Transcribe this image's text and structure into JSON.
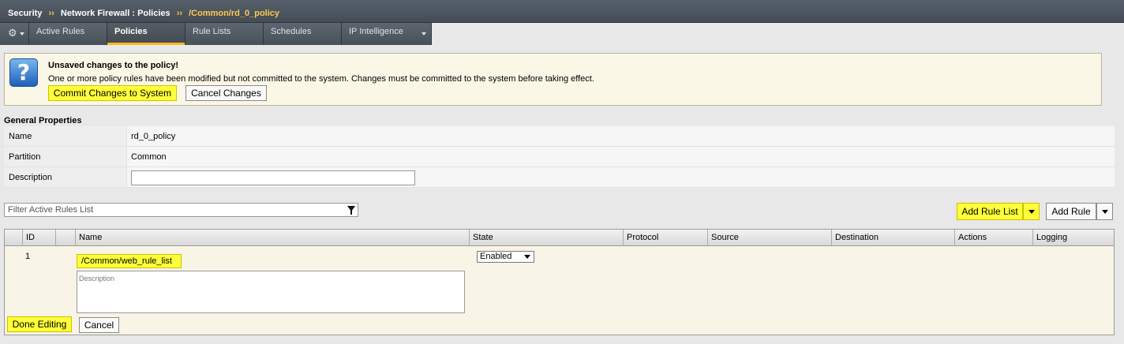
{
  "breadcrumb": {
    "root": "Security",
    "sep": "››",
    "section": "Network Firewall : Policies",
    "current": "/Common/rd_0_policy"
  },
  "tabs": [
    {
      "label": "Active Rules"
    },
    {
      "label": "Policies"
    },
    {
      "label": "Rule Lists"
    },
    {
      "label": "Schedules"
    },
    {
      "label": "IP Intelligence"
    }
  ],
  "notice": {
    "title": "Unsaved changes to the policy!",
    "message": "One or more policy rules have been modified but not committed to the system. Changes must be committed to the system before taking effect.",
    "commit_label": "Commit Changes to System",
    "cancel_label": "Cancel Changes"
  },
  "general": {
    "title": "General Properties",
    "rows": [
      {
        "label": "Name",
        "value": "rd_0_policy"
      },
      {
        "label": "Partition",
        "value": "Common"
      },
      {
        "label": "Description",
        "value": ""
      }
    ]
  },
  "filter": {
    "placeholder": "Filter Active Rules List"
  },
  "actions": {
    "add_rule_list": "Add Rule List",
    "add_rule": "Add Rule"
  },
  "grid": {
    "headers": [
      "ID",
      "Name",
      "State",
      "Protocol",
      "Source",
      "Destination",
      "Actions",
      "Logging"
    ],
    "row": {
      "id": "1",
      "name": "/Common/web_rule_list",
      "description_placeholder": "Description",
      "state": "Enabled"
    },
    "done_label": "Done Editing",
    "cancel_label": "Cancel"
  },
  "colors": {
    "highlight": "#ffff3a",
    "accent": "#ffb822",
    "header_bg": "#4b535d"
  }
}
